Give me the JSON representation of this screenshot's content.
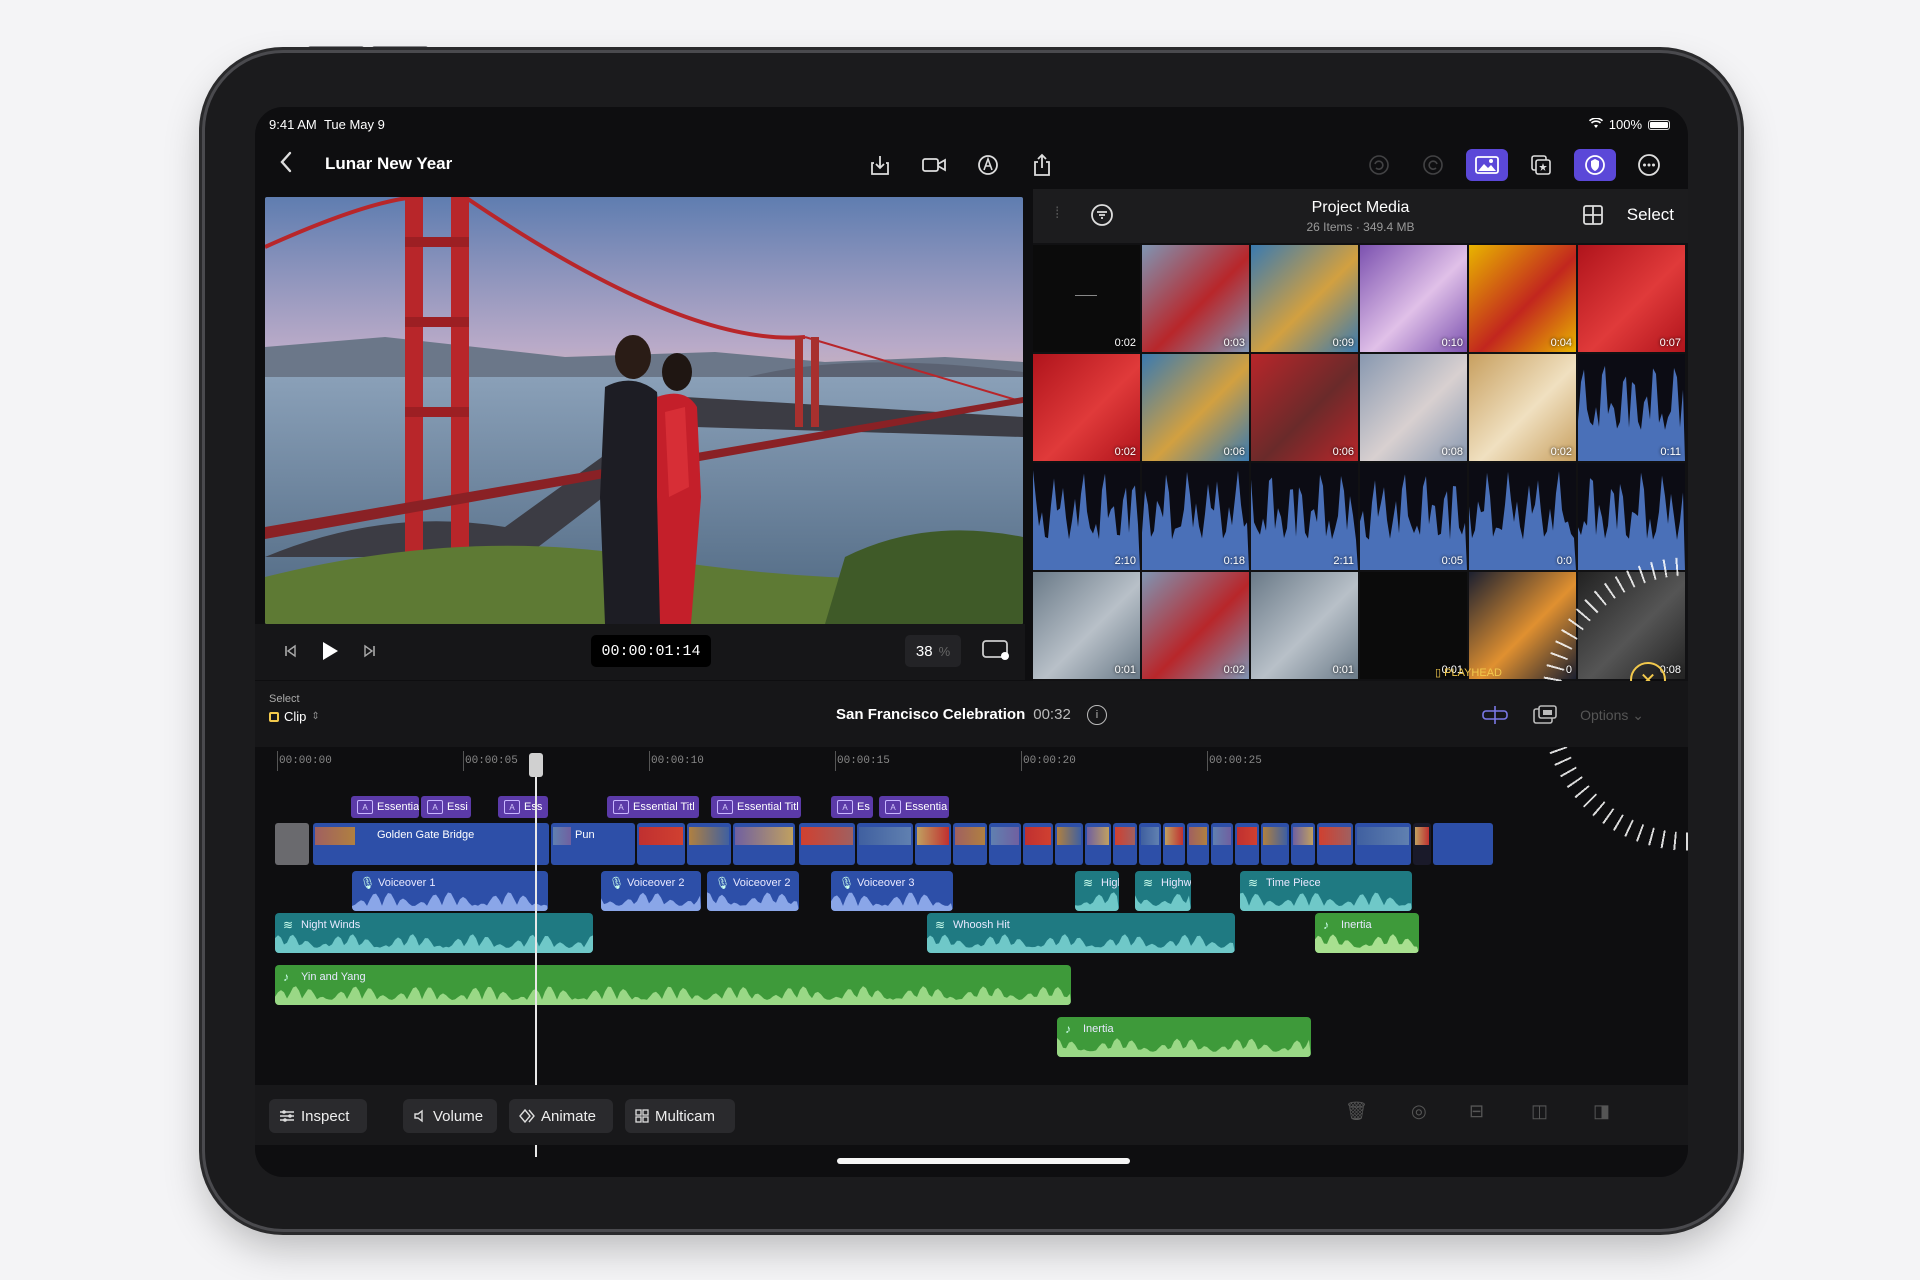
{
  "status": {
    "time": "9:41 AM",
    "date": "Tue May 9",
    "battery": "100%"
  },
  "nav": {
    "title": "Lunar New Year"
  },
  "viewer": {
    "timecode": "00:00:01:14",
    "zoom": "38",
    "zoom_unit": "%"
  },
  "browser": {
    "title": "Project Media",
    "subtitle": "26 Items · 349.4 MB",
    "select_label": "Select",
    "thumbs": [
      {
        "dur": "0:02",
        "kind": "black"
      },
      {
        "dur": "0:03",
        "kind": "bridge"
      },
      {
        "dur": "0:09",
        "kind": "mural"
      },
      {
        "dur": "0:10",
        "kind": "lion"
      },
      {
        "dur": "0:04",
        "kind": "yellow"
      },
      {
        "dur": "0:07",
        "kind": "red"
      },
      {
        "dur": "0:02",
        "kind": "red"
      },
      {
        "dur": "0:06",
        "kind": "mural"
      },
      {
        "dur": "0:06",
        "kind": "ribbons"
      },
      {
        "dur": "0:08",
        "kind": "people"
      },
      {
        "dur": "0:02",
        "kind": "cat"
      },
      {
        "dur": "0:11",
        "kind": "wave"
      },
      {
        "dur": "2:10",
        "kind": "wave"
      },
      {
        "dur": "0:18",
        "kind": "wave"
      },
      {
        "dur": "2:11",
        "kind": "wave"
      },
      {
        "dur": "0:05",
        "kind": "wave"
      },
      {
        "dur": "0:0",
        "kind": "wave"
      },
      {
        "dur": "",
        "kind": "wave"
      },
      {
        "dur": "0:01",
        "kind": "city"
      },
      {
        "dur": "0:02",
        "kind": "bridge"
      },
      {
        "dur": "0:01",
        "kind": "city"
      },
      {
        "dur": "0:01",
        "kind": "black"
      },
      {
        "dur": "0",
        "kind": "sunset"
      },
      {
        "dur": "0:08",
        "kind": "dark"
      }
    ],
    "playhead_label": "PLAYHEAD"
  },
  "timeline": {
    "select_label": "Select",
    "clip_label": "Clip",
    "project_name": "San Francisco Celebration",
    "project_duration": "00:32",
    "options_label": "Options",
    "ruler": [
      "00:00:00",
      "00:00:05",
      "00:00:10",
      "00:00:15",
      "00:00:20",
      "00:00:25"
    ],
    "titles": [
      {
        "label": "Essentia"
      },
      {
        "label": "Essi"
      },
      {
        "label": "Ess"
      },
      {
        "label": "Essential Titl"
      },
      {
        "label": "Essential Titl"
      },
      {
        "label": "Es"
      },
      {
        "label": "Essentia"
      }
    ],
    "primary_label": "Golden Gate Bridge",
    "primary_label2": "Pun",
    "voiceovers": [
      {
        "label": "Voiceover 1"
      },
      {
        "label": "Voiceover 2"
      },
      {
        "label": "Voiceover 2"
      },
      {
        "label": "Voiceover 3"
      },
      {
        "label": "High"
      },
      {
        "label": "Highw"
      },
      {
        "label": "Time Piece"
      }
    ],
    "fx": [
      {
        "label": "Night Winds"
      },
      {
        "label": "Whoosh Hit"
      },
      {
        "label": "Inertia"
      }
    ],
    "music": [
      {
        "label": "Yin and Yang"
      },
      {
        "label": "Inertia"
      }
    ]
  },
  "toolbar": {
    "inspect": "Inspect",
    "volume": "Volume",
    "animate": "Animate",
    "multicam": "Multicam"
  },
  "colors": {
    "accent_purple": "#5b48d8",
    "title_clip": "#5b3aa8",
    "video_clip": "#2d4fa8",
    "audio_teal": "#1f7a82",
    "music_green": "#3e9a3a",
    "playhead_yellow": "#f2c94c"
  }
}
